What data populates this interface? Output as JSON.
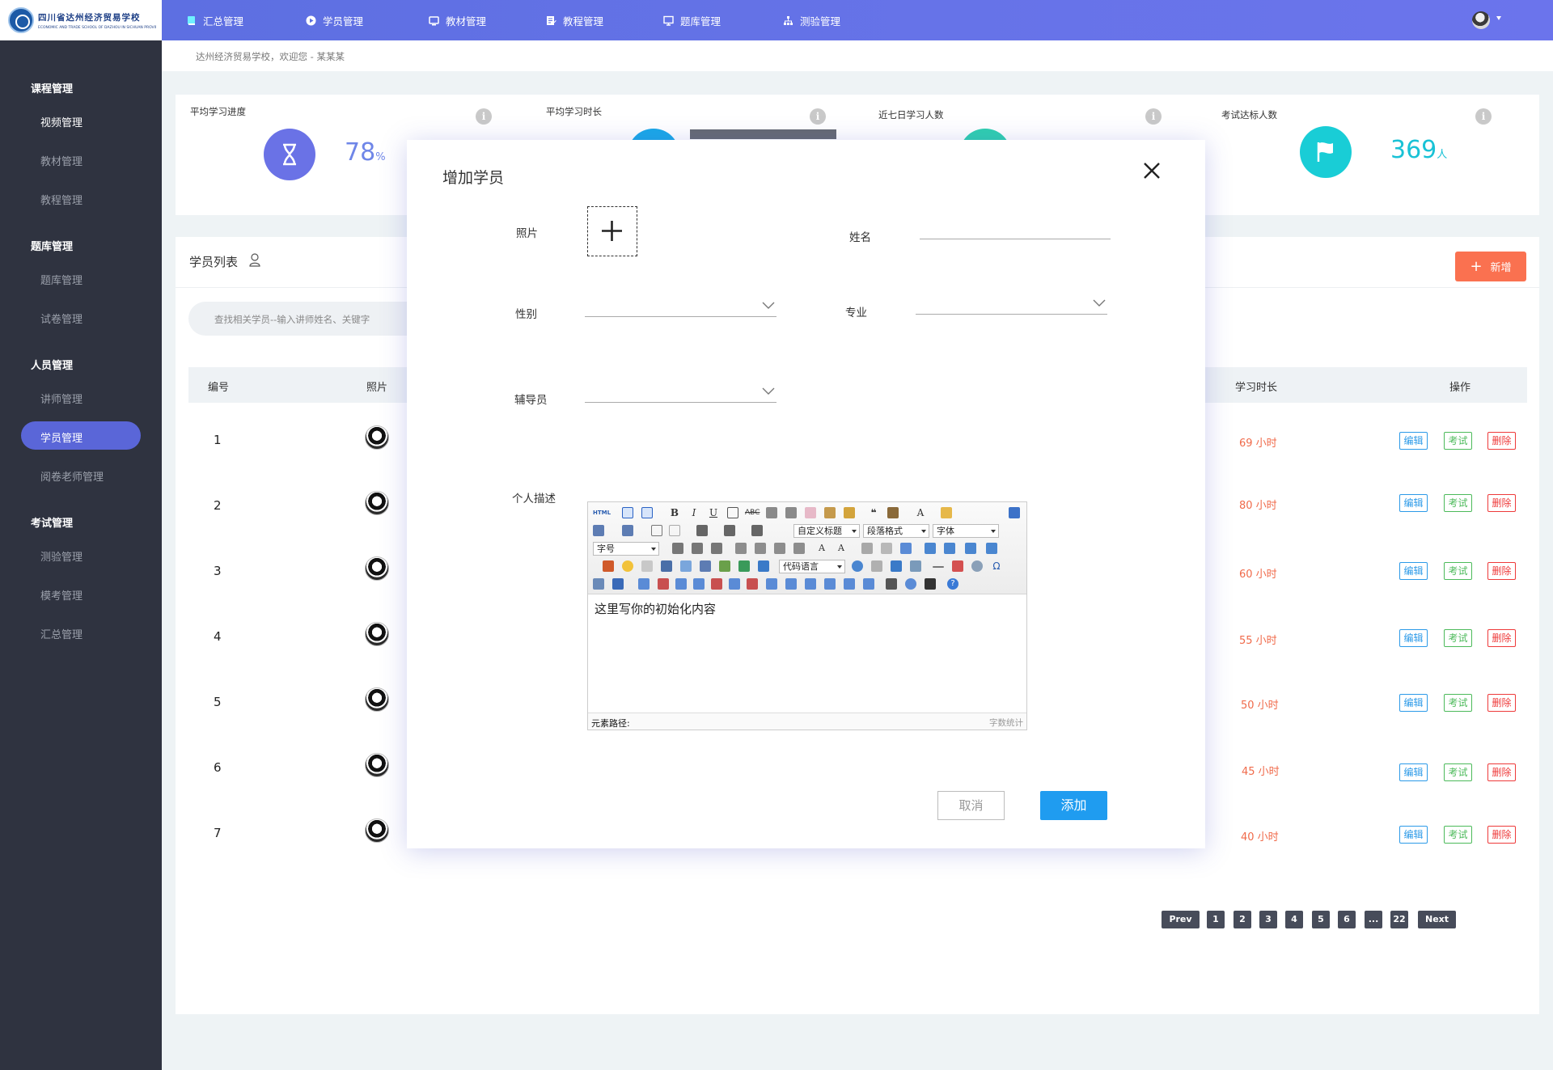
{
  "header": {
    "school_name": "四川省达州经济贸易学校",
    "school_name_en": "ECONOMIC AND TRADE SCHOOL OF DAZHOU IN SICHUAN PROVINCE",
    "nav": [
      {
        "label": "汇总管理"
      },
      {
        "label": "学员管理"
      },
      {
        "label": "教材管理"
      },
      {
        "label": "教程管理"
      },
      {
        "label": "题库管理"
      },
      {
        "label": "测验管理"
      }
    ]
  },
  "sidebar": {
    "groups": [
      {
        "title": "课程管理",
        "items": [
          "视频管理",
          "教材管理",
          "教程管理"
        ]
      },
      {
        "title": "题库管理",
        "items": [
          "题库管理",
          "试卷管理"
        ]
      },
      {
        "title": "人员管理",
        "items": [
          "讲师管理",
          "学员管理",
          "阅卷老师管理"
        ]
      },
      {
        "title": "考试管理",
        "items": [
          "测验管理",
          "模考管理",
          "汇总管理"
        ]
      }
    ],
    "active_item": "学员管理"
  },
  "breadcrumb": "达州经济贸易学校，欢迎您 - 某某某",
  "stats": {
    "avg_progress": {
      "title": "平均学习进度",
      "value": "78",
      "unit": "%"
    },
    "avg_duration": {
      "title": "平均学习时长"
    },
    "recent_learners": {
      "title": "近七日学习人数"
    },
    "exam_passed": {
      "title": "考试达标人数",
      "value": "369",
      "unit": "人"
    },
    "colors": {
      "progress": "#6a72e6",
      "duration": "#1aa8e8",
      "recent": "#2fcfb0",
      "passed": "#19cdd6"
    }
  },
  "list": {
    "title": "学员列表",
    "add_label": "新增",
    "search_placeholder": "查找相关学员--输入讲师姓名、关键字",
    "columns": {
      "id": "编号",
      "photo": "照片",
      "hours": "学习时长",
      "ops": "操作"
    },
    "rows": [
      {
        "id": "1",
        "hours": "69 小时"
      },
      {
        "id": "2",
        "hours": "80 小时"
      },
      {
        "id": "3",
        "hours": "60 小时"
      },
      {
        "id": "4",
        "hours": "55 小时"
      },
      {
        "id": "5",
        "hours": "50 小时"
      },
      {
        "id": "6",
        "hours": "45 小时"
      },
      {
        "id": "7",
        "hours": "40 小时"
      }
    ],
    "ops": {
      "edit": "编辑",
      "exam": "考试",
      "delete": "删除"
    }
  },
  "pagination": {
    "prev": "Prev",
    "pages": [
      "1",
      "2",
      "3",
      "4",
      "5",
      "6",
      "...",
      "22"
    ],
    "next": "Next"
  },
  "modal": {
    "title": "增加学员",
    "labels": {
      "photo": "照片",
      "name": "姓名",
      "gender": "性别",
      "major": "专业",
      "tutor": "辅导员",
      "description": "个人描述"
    },
    "values": {
      "name": "",
      "gender": "",
      "major": "",
      "tutor": ""
    },
    "editor": {
      "html_label": "HTML",
      "custom_heading": "自定义标题",
      "paragraph_format": "段落格式",
      "font_family": "字体",
      "font_size": "字号",
      "code_language": "代码语言",
      "content": "这里写你的初始化内容",
      "path_label": "元素路径:",
      "word_count_label": "字数统计"
    },
    "cancel_label": "取消",
    "submit_label": "添加"
  }
}
